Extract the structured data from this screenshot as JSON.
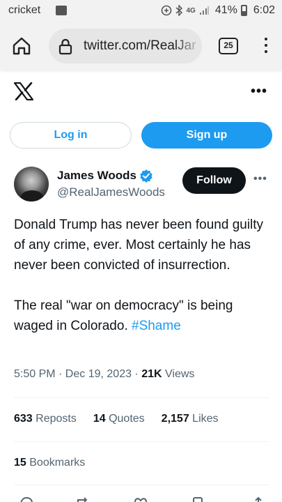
{
  "status_bar": {
    "carrier": "cricket",
    "network": "4G",
    "battery": "41%",
    "time": "6:02"
  },
  "browser": {
    "url": "twitter.com/RealJar",
    "tab_count": "25"
  },
  "header": {
    "logo": "x-logo-icon",
    "more": "•••"
  },
  "auth": {
    "login_label": "Log in",
    "signup_label": "Sign up"
  },
  "tweet": {
    "author_name": "James Woods",
    "author_handle": "@RealJamesWoods",
    "follow_label": "Follow",
    "more": "•••",
    "paragraph1": "Donald Trump has never been found guilty of any crime, ever. Most certainly he has never been convicted of insurrection.",
    "paragraph2_text": "The real \"war on democracy\" is being waged in Colorado. ",
    "hashtag": "#Shame",
    "time": "5:50 PM · Dec 19, 2023 · ",
    "views_count": "21K",
    "views_label": " Views",
    "stats": {
      "reposts_count": "633",
      "reposts_label": " Reposts",
      "quotes_count": "14",
      "quotes_label": " Quotes",
      "likes_count": "2,157",
      "likes_label": " Likes",
      "bookmarks_count": "15",
      "bookmarks_label": " Bookmarks"
    }
  },
  "colors": {
    "accent": "#1d9bf0",
    "text": "#0f1419",
    "secondary": "#536471",
    "verified": "#1d9bf0"
  }
}
